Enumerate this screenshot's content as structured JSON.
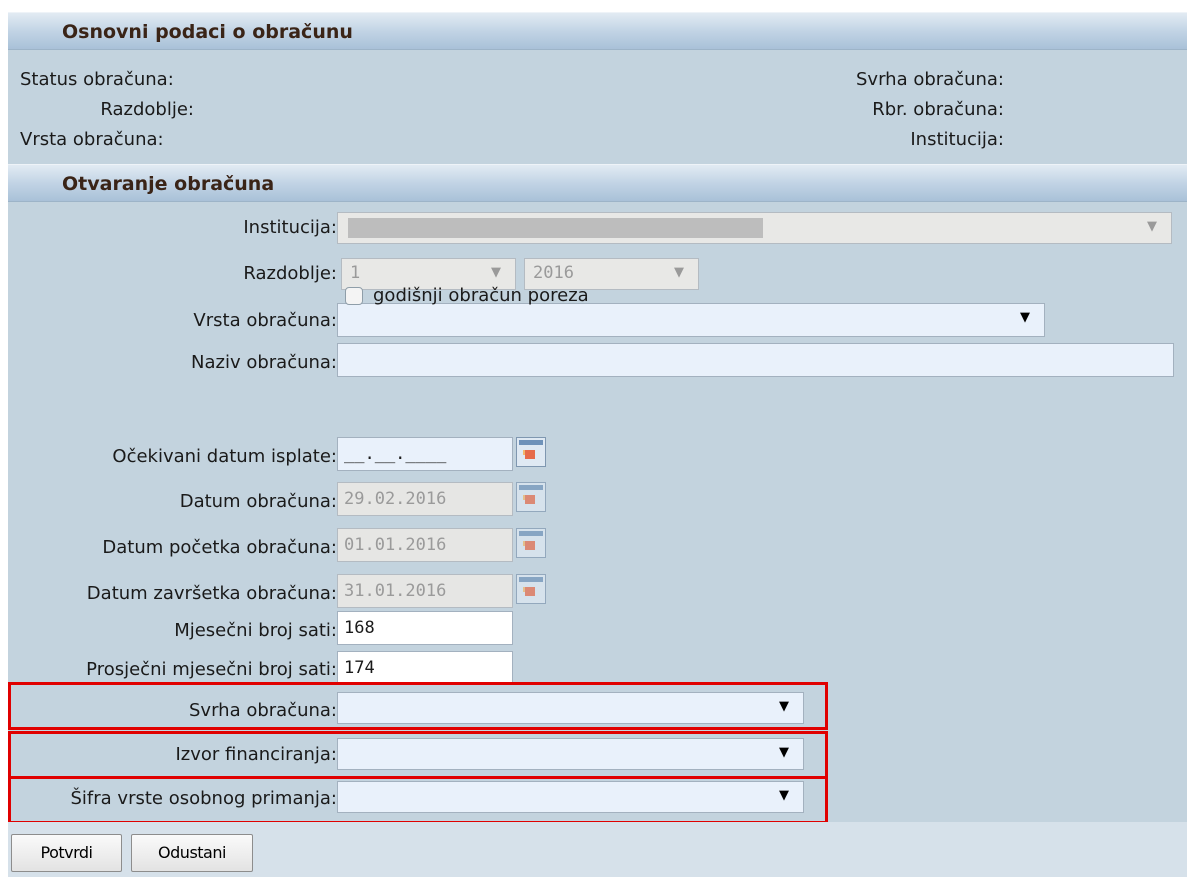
{
  "header1": {
    "title": "Osnovni podaci o obračunu",
    "status_label": "Status obračuna:",
    "razdoblje_label": "Razdoblje:",
    "vrsta_label": "Vrsta obračuna:",
    "svrha_label": "Svrha obračuna:",
    "rbr_label": "Rbr. obračuna:",
    "institucija_label": "Institucija:"
  },
  "header2": {
    "title": "Otvaranje obračuna"
  },
  "form": {
    "institucija": {
      "label": "Institucija:",
      "value": ""
    },
    "razdoblje": {
      "label": "Razdoblje:",
      "month": "1",
      "year": "2016"
    },
    "vrsta": {
      "label": "Vrsta obračuna:",
      "value": ""
    },
    "naziv": {
      "label": "Naziv obračuna:",
      "value": ""
    },
    "godisnji": {
      "label": "godišnji obračun poreza",
      "checked": false
    },
    "ocekivani_datum": {
      "label": "Očekivani datum isplate:",
      "value": "__.__.____"
    },
    "datum_obracuna": {
      "label": "Datum obračuna:",
      "value": "29.02.2016"
    },
    "datum_pocetka": {
      "label": "Datum početka obračuna:",
      "value": "01.01.2016"
    },
    "datum_zavrsetka": {
      "label": "Datum završetka obračuna:",
      "value": "31.01.2016"
    },
    "mjesecni_sati": {
      "label": "Mjesečni broj sati:",
      "value": "168"
    },
    "prosjecni_sati": {
      "label": "Prosječni mjesečni broj sati:",
      "value": "174"
    },
    "svrha": {
      "label": "Svrha obračuna:",
      "value": ""
    },
    "izvor": {
      "label": "Izvor financiranja:",
      "value": ""
    },
    "sifra": {
      "label": "Šifra vrste osobnog primanja:",
      "value": ""
    }
  },
  "buttons": {
    "confirm": "Potvrdi",
    "cancel": "Odustani"
  },
  "icons": {
    "dropdown": "▼",
    "calendar": "calendar-icon"
  },
  "colors": {
    "highlight": "#e00000",
    "panel": "#c3d3de"
  }
}
